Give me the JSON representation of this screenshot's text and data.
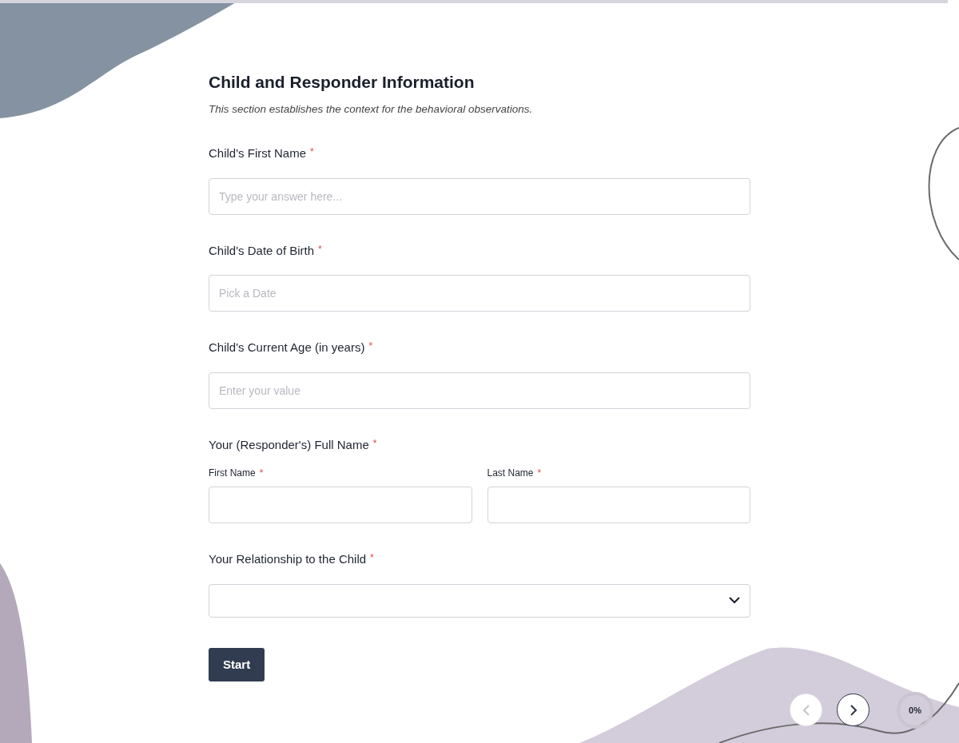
{
  "section": {
    "title": "Child and Responder Information",
    "description": "This section establishes the context for the behavioral observations."
  },
  "required_marker": "*",
  "fields": [
    {
      "kind": "text",
      "label": "Child's First Name",
      "required": true,
      "placeholder": "Type your answer here..."
    },
    {
      "kind": "date",
      "label": "Child's Date of Birth",
      "required": true,
      "placeholder": "Pick a Date"
    },
    {
      "kind": "number",
      "label": "Child's Current Age (in years)",
      "required": true,
      "placeholder": "Enter your value"
    },
    {
      "kind": "name",
      "label": "Your (Responder's) Full Name",
      "required": true,
      "parts": [
        {
          "label": "First Name",
          "required": true
        },
        {
          "label": "Last Name",
          "required": true
        }
      ]
    },
    {
      "kind": "select",
      "label": "Your Relationship to the Child",
      "required": true
    }
  ],
  "start_button": "Start",
  "navigation": {
    "previous": {
      "disabled": true
    },
    "next": {
      "disabled": false
    }
  },
  "progress": {
    "level": 0,
    "reading": "0%"
  }
}
